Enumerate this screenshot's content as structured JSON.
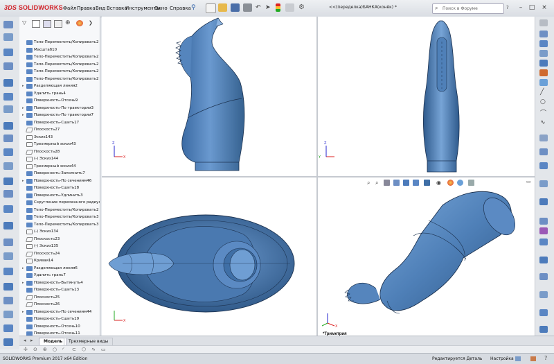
{
  "app": {
    "logo_prefix": "3DS",
    "logo_name": "SOLIDWORKS",
    "document_title": "<<(переделка)БАНКА(конёк) *",
    "search_placeholder": "Поиск в Форуме"
  },
  "menu": [
    "Файл",
    "Правка",
    "Вид",
    "Вставка",
    "Инструменты",
    "Окно",
    "Справка"
  ],
  "tree": {
    "items": [
      {
        "label": "Тело-Переместить/Копировать2",
        "icon": "body-move-icon",
        "exp": ""
      },
      {
        "label": "Масштаб10",
        "icon": "scale-icon",
        "exp": ""
      },
      {
        "label": "Тело-Переместить/Копировать2",
        "icon": "body-move-icon",
        "exp": ""
      },
      {
        "label": "Тело-Переместить/Копировать2",
        "icon": "body-move-icon",
        "exp": ""
      },
      {
        "label": "Тело-Переместить/Копировать2",
        "icon": "body-move-icon",
        "exp": ""
      },
      {
        "label": "Тело-Переместить/Копировать2",
        "icon": "body-move-icon",
        "exp": ""
      },
      {
        "label": "Разделяющая линия2",
        "icon": "split-line-icon",
        "exp": "▸"
      },
      {
        "label": "Удалить грань4",
        "icon": "delete-face-icon",
        "exp": ""
      },
      {
        "label": "Поверхность-Отсечь9",
        "icon": "surface-trim-icon",
        "exp": ""
      },
      {
        "label": "Поверхность-По траектории3",
        "icon": "surface-sweep-icon",
        "exp": "▸"
      },
      {
        "label": "Поверхность-По траектории7",
        "icon": "surface-sweep-icon",
        "exp": "▸"
      },
      {
        "label": "Поверхность-Сшить17",
        "icon": "surface-knit-icon",
        "exp": ""
      },
      {
        "label": "Плоскость27",
        "icon": "plane-icon",
        "exp": ""
      },
      {
        "label": "Эскиз143",
        "icon": "sketch-icon",
        "exp": ""
      },
      {
        "label": "Трехмерный эскиз43",
        "icon": "sketch3d-icon",
        "exp": ""
      },
      {
        "label": "Плоскость28",
        "icon": "plane-icon",
        "exp": ""
      },
      {
        "label": "(-) Эскиз144",
        "icon": "sketch-icon",
        "exp": ""
      },
      {
        "label": "Трехмерный эскиз44",
        "icon": "sketch3d-icon",
        "exp": ""
      },
      {
        "label": "Поверхность-Заполнить7",
        "icon": "surface-fill-icon",
        "exp": ""
      },
      {
        "label": "Поверхность-По сечениям46",
        "icon": "surface-loft-icon",
        "exp": "▸"
      },
      {
        "label": "Поверхность-Сшить18",
        "icon": "surface-knit-icon",
        "exp": ""
      },
      {
        "label": "Поверхность-Удлинить3",
        "icon": "surface-extend-icon",
        "exp": ""
      },
      {
        "label": "Скругление переменного радиуса",
        "icon": "fillet-icon",
        "exp": ""
      },
      {
        "label": "Тело-Переместить/Копировать2",
        "icon": "body-move-icon",
        "exp": ""
      },
      {
        "label": "Тело-Переместить/Копировать3",
        "icon": "body-move-icon",
        "exp": ""
      },
      {
        "label": "Тело-Переместить/Копировать3",
        "icon": "body-move-icon",
        "exp": ""
      },
      {
        "label": "(-) Эскиз134",
        "icon": "sketch-icon",
        "exp": ""
      },
      {
        "label": "Плоскость23",
        "icon": "plane-icon",
        "exp": ""
      },
      {
        "label": "(-) Эскиз135",
        "icon": "sketch-icon",
        "exp": ""
      },
      {
        "label": "Плоскость24",
        "icon": "plane-icon",
        "exp": ""
      },
      {
        "label": "Кривая14",
        "icon": "curve-icon",
        "exp": ""
      },
      {
        "label": "Разделяющая линия6",
        "icon": "split-line-icon",
        "exp": "▸"
      },
      {
        "label": "Удалить грань7",
        "icon": "delete-face-icon",
        "exp": ""
      },
      {
        "label": "Поверхность-Вытянуть4",
        "icon": "surface-extrude-icon",
        "exp": "▸"
      },
      {
        "label": "Поверхность-Сшить13",
        "icon": "surface-knit-icon",
        "exp": ""
      },
      {
        "label": "Плоскость25",
        "icon": "plane-icon",
        "exp": ""
      },
      {
        "label": "Плоскость26",
        "icon": "plane-icon",
        "exp": ""
      },
      {
        "label": "Поверхность-По сечениям44",
        "icon": "surface-loft-icon",
        "exp": "▸"
      },
      {
        "label": "Поверхность-Сшить19",
        "icon": "surface-knit-icon",
        "exp": ""
      },
      {
        "label": "Поверхность-Отсечь10",
        "icon": "surface-trim-icon",
        "exp": ""
      },
      {
        "label": "Поверхность-Отсечь11",
        "icon": "surface-trim-icon",
        "exp": ""
      }
    ]
  },
  "tabs": {
    "model": "Модель",
    "motion": "Трехмерные виды"
  },
  "views": {
    "iso_label": "*Триметрия"
  },
  "status": {
    "edition": "SOLIDWORKS Premium 2017 x64 Edition",
    "mode": "Редактируется Деталь",
    "custom": "Настройка"
  },
  "colors": {
    "accent": "#d11f26",
    "model_fill": "#4f80b8",
    "model_edge": "#1c3250",
    "triad_x": "#d22",
    "triad_y": "#2a2",
    "triad_z": "#22c"
  }
}
